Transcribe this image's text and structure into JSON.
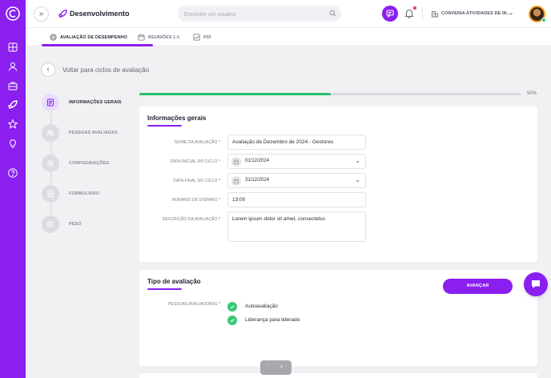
{
  "colors": {
    "accent": "#8a1ff0",
    "success": "#26c06a",
    "danger": "#e0245e"
  },
  "rail": {
    "icons": [
      "logo-icon",
      "grid-icon",
      "user-icon",
      "briefcase-icon",
      "rocket-icon",
      "star-icon",
      "lightbulb-icon",
      "help-icon"
    ]
  },
  "header": {
    "expand_glyph": "»",
    "page_title": "Desenvolvimento",
    "search_placeholder": "Encontre um usuário",
    "company": "CONVENIA ATIVIDADES DE IN...",
    "company_chevron": "⌄"
  },
  "tabs": [
    {
      "label": "AVALIAÇÃO DE DESEMPENHO",
      "active": true
    },
    {
      "label": "REUNIÕES 1:1",
      "active": false
    },
    {
      "label": "PDI",
      "active": false
    }
  ],
  "back": {
    "glyph": "‹",
    "label": "Voltar para ciclos de avaliação"
  },
  "steps": [
    {
      "label": "INFORMAÇÕES GERAIS",
      "active": true
    },
    {
      "label": "PESSOAS AVALIADAS",
      "active": false
    },
    {
      "label": "CONFIGURAÇÕES",
      "active": false
    },
    {
      "label": "FORMULÁRIO",
      "active": false
    },
    {
      "label": "PESO",
      "active": false
    }
  ],
  "progress": {
    "percent": 50,
    "label": "50%"
  },
  "general_info": {
    "title": "Informações gerais",
    "required_mark": "*",
    "fields": {
      "name": {
        "label": "NOME DA AVALIAÇÃO",
        "value": "Avaliação de Dezembro de 2024 - Gestores"
      },
      "start_date": {
        "label": "DATA INICIAL DO CICLO",
        "value": "01/12/2024"
      },
      "end_date": {
        "label": "DATA FINAL DO CICLO",
        "value": "31/12/2024"
      },
      "trigger_time": {
        "label": "HORÁRIO DE DISPARO",
        "value": "13:00"
      },
      "description": {
        "label": "DESCRIÇÃO DA AVALIAÇÃO",
        "value": "Lorem ipsum dolor sit amet, consectetur."
      }
    },
    "chevron": "⌄"
  },
  "evaluation_type": {
    "title": "Tipo de avaliação",
    "evaluators_label": "PESSOAS AVALIADORAS",
    "options": [
      {
        "label": "Autoavaliação",
        "checked": true
      },
      {
        "label": "Liderança para liderado",
        "checked": true
      }
    ]
  },
  "actions": {
    "next_label": "AVANÇAR"
  },
  "pager": {
    "prev": "‹",
    "next": "›"
  }
}
